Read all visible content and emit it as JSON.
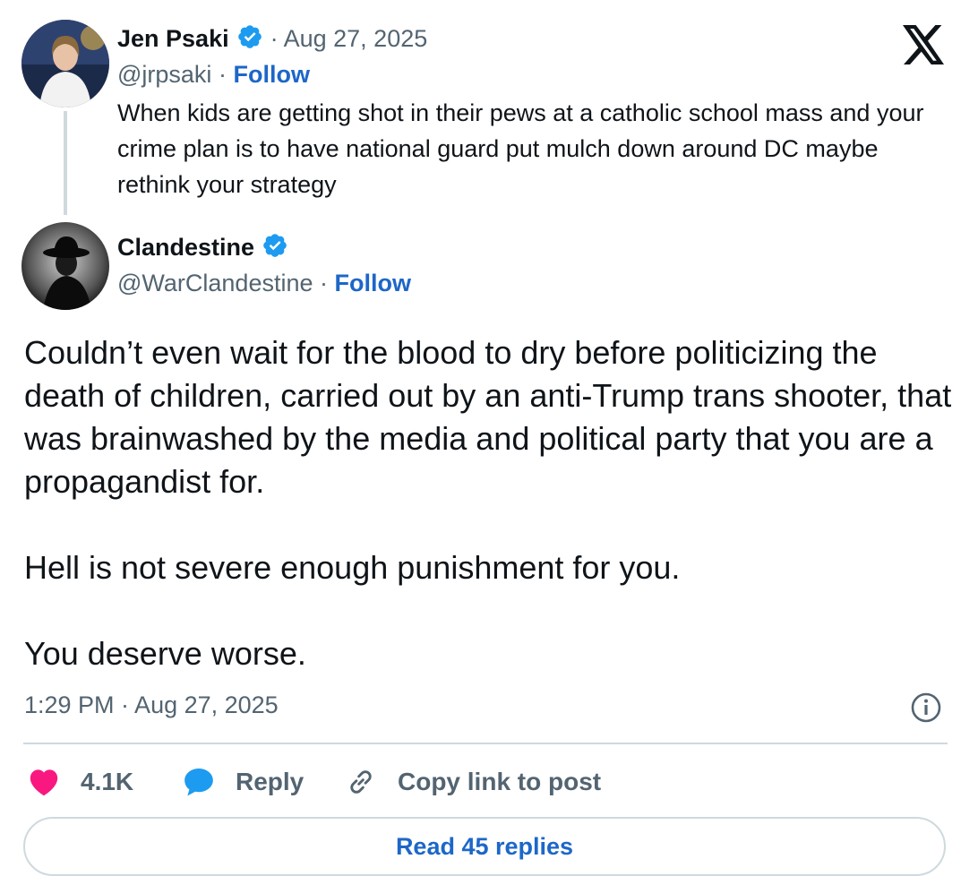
{
  "brand": {
    "icon": "x-logo-icon"
  },
  "quoted_post": {
    "author_name": "Jen Psaki",
    "date": "· Aug 27, 2025",
    "handle": "@jrpsaki",
    "separator": "·",
    "follow_label": "Follow",
    "text": "When kids are getting shot in their pews at a catholic school mass and your crime plan is to have national guard put mulch down around DC maybe rethink your strategy",
    "verified_icon": "verified-badge-icon"
  },
  "post": {
    "author_name": "Clandestine",
    "handle": "@WarClandestine",
    "separator": "·",
    "follow_label": "Follow",
    "text": "Couldn’t even wait for the blood to dry before politicizing the death of children, carried out by an anti-Trump trans shooter, that was brainwashed by the media and political party that you are a propagandist for.\n\nHell is not severe enough punishment for you.\n\nYou deserve worse.",
    "timestamp": "1:29 PM · Aug 27, 2025",
    "info_icon": "info-icon",
    "verified_icon": "verified-badge-icon"
  },
  "actions": {
    "like_count": "4.1K",
    "reply_label": "Reply",
    "copy_link_label": "Copy link to post"
  },
  "read_replies_label": "Read 45 replies",
  "colors": {
    "accent": "#1d67c8",
    "verified": "#1d9bf0",
    "heart": "#f91880",
    "muted": "#536471",
    "divider": "#cfd9de"
  }
}
